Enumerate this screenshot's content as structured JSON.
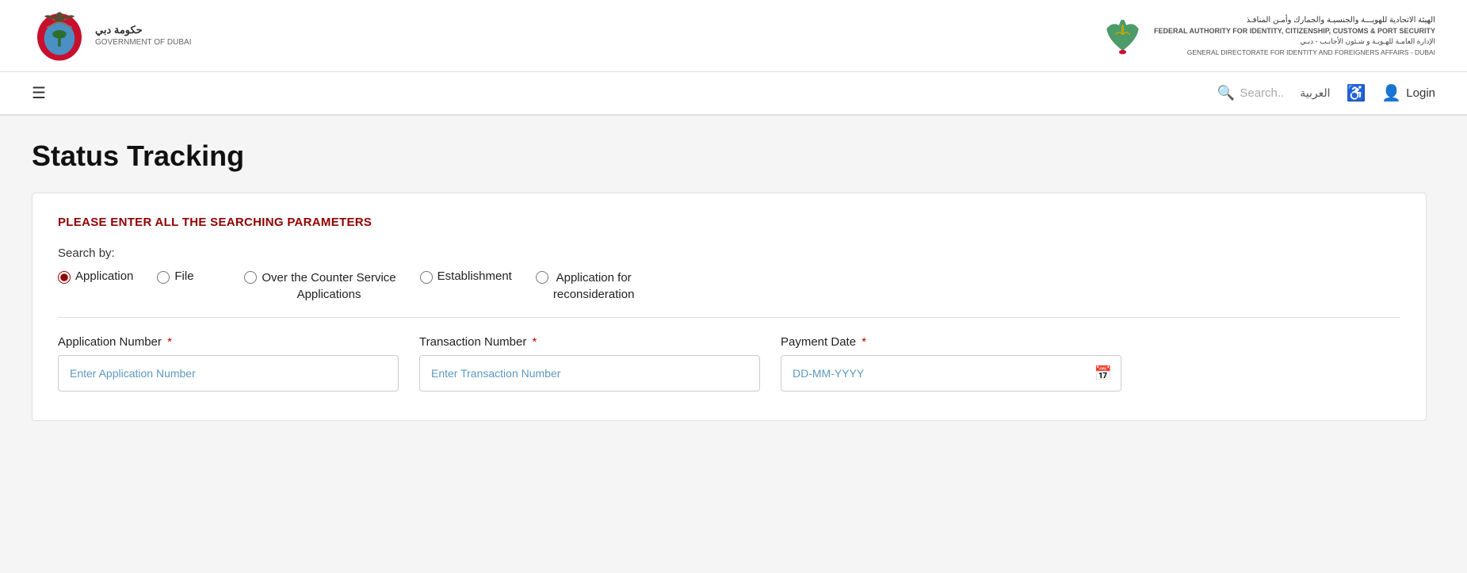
{
  "header": {
    "gov_arabic": "حكومة دبي",
    "gov_english": "GOVERNMENT OF DUBAI",
    "org_arabic_line1": "الهيئة الاتحادية للهويـــة والجنسيـة والجمارك وأمـن المنافـذ",
    "org_english": "FEDERAL AUTHORITY FOR IDENTITY, CITIZENSHIP, CUSTOMS & PORT SECURITY",
    "org_sub_arabic": "الإدارة العامـة للهـويـة و شـئون الأجانـب - دبـي",
    "org_sub_english": "GENERAL DIRECTORATE FOR IDENTITY AND FOREIGNERS AFFAIRS - DUBAI"
  },
  "navbar": {
    "search_placeholder": "Search..",
    "lang_label": "العربية",
    "login_label": "Login"
  },
  "page": {
    "title": "Status Tracking"
  },
  "card": {
    "heading": "PLEASE ENTER ALL THE SEARCHING PARAMETERS",
    "search_by_label": "Search by:",
    "radio_options": [
      {
        "id": "opt-application",
        "label": "Application",
        "checked": true
      },
      {
        "id": "opt-file",
        "label": "File",
        "checked": false
      },
      {
        "id": "opt-otc",
        "label": "Over the Counter Service\nApplications",
        "checked": false
      },
      {
        "id": "opt-establishment",
        "label": "Establishment",
        "checked": false
      },
      {
        "id": "opt-reconsideration",
        "label": "Application for\nreconsideration",
        "checked": false
      }
    ],
    "fields": [
      {
        "id": "application-number",
        "label": "Application Number",
        "required": true,
        "placeholder": "Enter Application Number",
        "type": "text"
      },
      {
        "id": "transaction-number",
        "label": "Transaction Number",
        "required": true,
        "placeholder": "Enter Transaction Number",
        "type": "text"
      },
      {
        "id": "payment-date",
        "label": "Payment Date",
        "required": true,
        "placeholder": "DD-MM-YYYY",
        "type": "text"
      }
    ]
  },
  "colors": {
    "accent": "#900000",
    "link": "#5c9abf"
  }
}
